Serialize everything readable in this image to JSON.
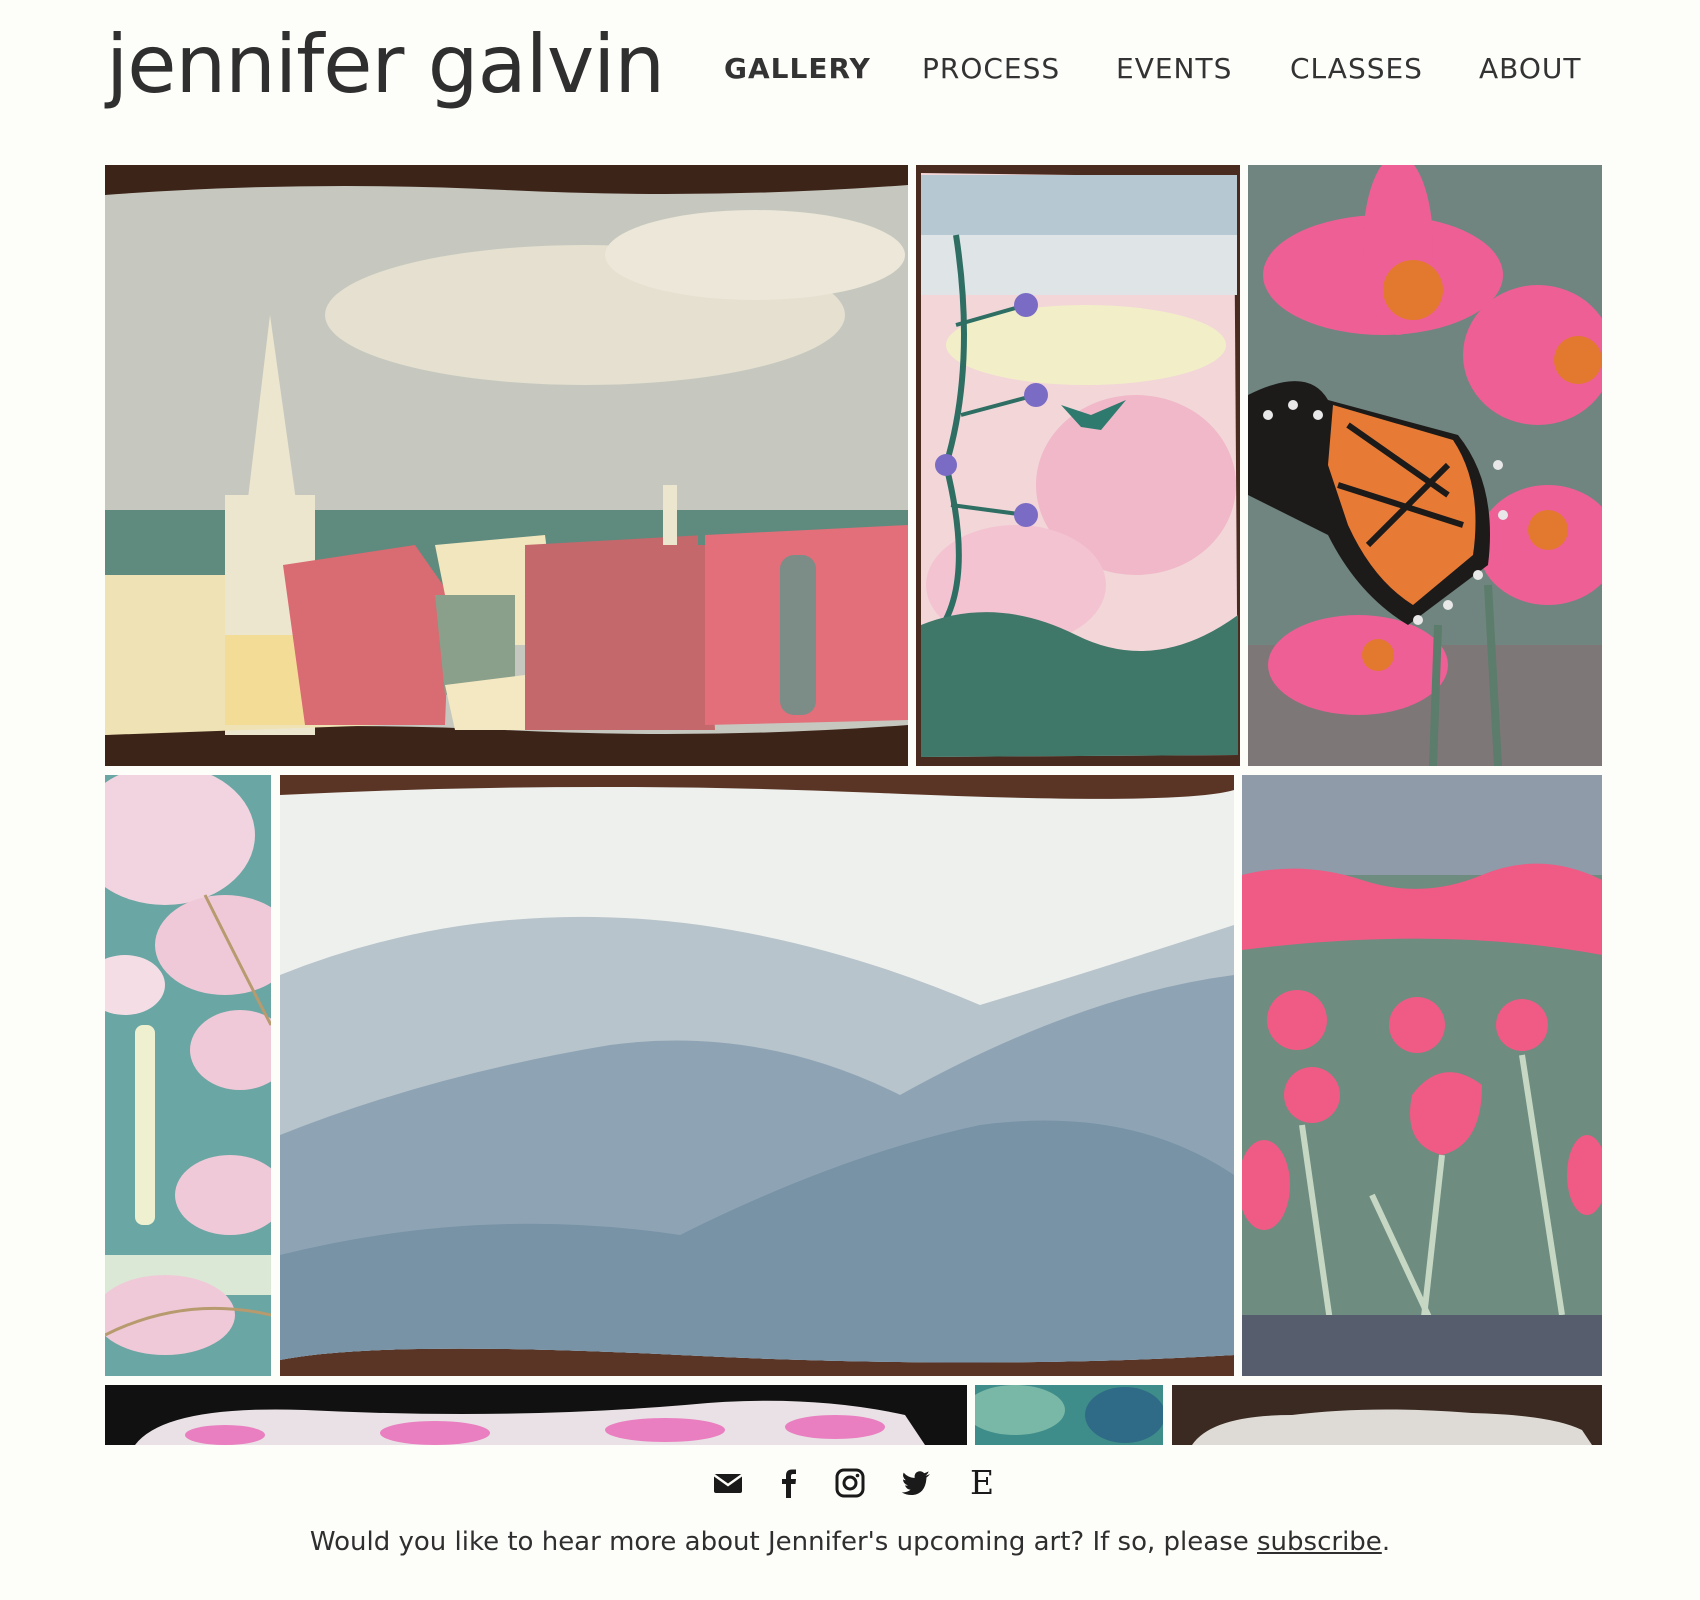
{
  "site": {
    "title": "jennifer galvin"
  },
  "nav": {
    "items": [
      {
        "label": "GALLERY",
        "active": true
      },
      {
        "label": "PROCESS",
        "active": false
      },
      {
        "label": "EVENTS",
        "active": false
      },
      {
        "label": "CLASSES",
        "active": false
      },
      {
        "label": "ABOUT",
        "active": false
      }
    ]
  },
  "gallery": {
    "tiles": [
      {
        "subject": "cityscape",
        "icon": "paper-cityscape-image"
      },
      {
        "subject": "hummingbird",
        "icon": "paper-hummingbird-image"
      },
      {
        "subject": "butterfly",
        "icon": "paper-monarch-butterfly-image"
      },
      {
        "subject": "cherry-blossom-monument",
        "icon": "paper-cherry-blossom-image"
      },
      {
        "subject": "mountains",
        "icon": "paper-blue-mountains-image"
      },
      {
        "subject": "tulips",
        "icon": "paper-tulips-image"
      },
      {
        "subject": "flowers-dark",
        "icon": "paper-pink-flowers-image"
      },
      {
        "subject": "blue-green",
        "icon": "paper-blue-green-image"
      },
      {
        "subject": "gray-paper",
        "icon": "paper-gray-image"
      }
    ]
  },
  "footer": {
    "icons": [
      "envelope-icon",
      "facebook-icon",
      "instagram-icon",
      "twitter-icon",
      "etsy-icon"
    ],
    "etsy_glyph": "E",
    "subscribe_prefix": "Would you like to hear more about Jennifer's upcoming art? If so, please ",
    "subscribe_link": "subscribe",
    "subscribe_suffix": "."
  },
  "colors": {
    "background": "#fdfdfa",
    "text": "#2f2f2f",
    "wood": "#5a3526"
  }
}
